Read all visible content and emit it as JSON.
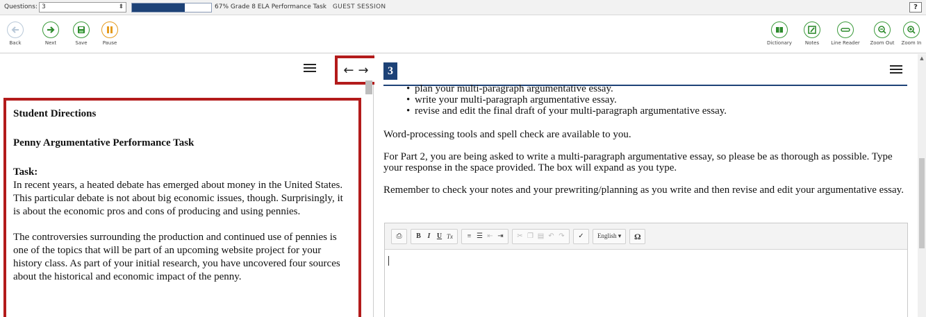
{
  "topbar": {
    "questions_label": "Questions:",
    "questions_value": "3",
    "progress_fraction": 0.67,
    "progress_text": "67%",
    "test_name": "Grade 8 ELA Performance Task",
    "session": "GUEST SESSION",
    "help_label": "?"
  },
  "toolbar": {
    "left": [
      {
        "label": "Back",
        "icon": "back-arrow-icon"
      },
      {
        "label": "Next",
        "icon": "next-arrow-icon"
      },
      {
        "label": "Save",
        "icon": "save-icon"
      },
      {
        "label": "Pause",
        "icon": "pause-icon"
      }
    ],
    "right": [
      {
        "label": "Dictionary",
        "icon": "dictionary-icon"
      },
      {
        "label": "Notes",
        "icon": "notes-icon"
      },
      {
        "label": "Line Reader",
        "icon": "line-reader-icon"
      },
      {
        "label": "Zoom Out",
        "icon": "zoom-out-icon"
      },
      {
        "label": "Zoom In",
        "icon": "zoom-in-icon"
      }
    ]
  },
  "left_panel": {
    "arrows": {
      "left": "←",
      "right": "→"
    },
    "title": "Student Directions",
    "subtitle": "Penny Argumentative Performance Task",
    "task_heading": "Task:",
    "paragraph1": "In recent years, a heated debate has emerged about money in the United States. This particular debate is not about big economic issues, though. Surprisingly, it is about the economic pros and cons of producing and using pennies.",
    "paragraph2": "The controversies surrounding the production and continued use of pennies is one of the topics that will be part of an upcoming website project for your history class. As part of your initial research, you have uncovered four sources about the historical and economic impact of the penny."
  },
  "right_panel": {
    "question_number": "3",
    "bullets": [
      "plan your multi-paragraph argumentative essay.",
      "write your multi-paragraph argumentative essay.",
      "revise and edit the final draft of your multi-paragraph argumentative essay."
    ],
    "p1": "Word-processing tools and spell check are available to you.",
    "p2": "For Part 2, you are being asked to write a multi-paragraph argumentative essay, so please be as thorough as possible. Type your response in the space provided. The box will expand as you type.",
    "p3": "Remember to check your notes and your prewriting/planning as you write and then revise and edit your argumentative essay.",
    "editor": {
      "bold": "B",
      "italic": "I",
      "underline": "U",
      "clear_format": "Tx",
      "language": "English ▾",
      "special_char": "Ω"
    }
  }
}
